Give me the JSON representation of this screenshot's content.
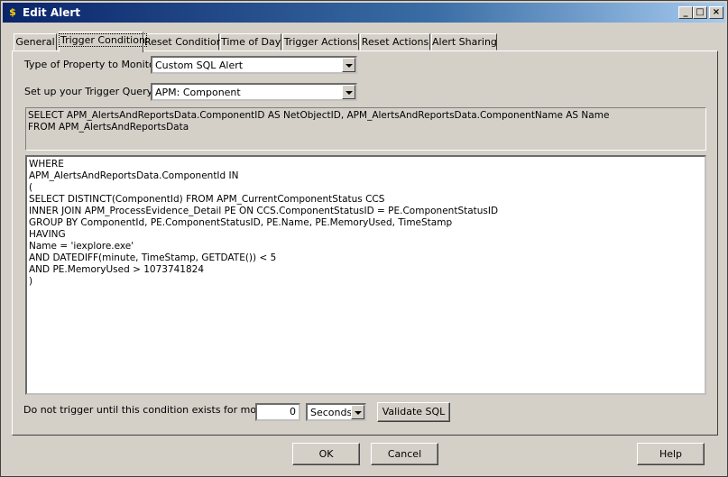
{
  "window": {
    "title": "Edit Alert"
  },
  "titlebar_buttons": {
    "minimize": "_",
    "maximize": "□",
    "close": "×"
  },
  "tabs": [
    {
      "label": "General"
    },
    {
      "label": "Trigger Condition"
    },
    {
      "label": "Reset Condition"
    },
    {
      "label": "Time of Day"
    },
    {
      "label": "Trigger Actions"
    },
    {
      "label": "Reset Actions"
    },
    {
      "label": "Alert Sharing"
    }
  ],
  "form": {
    "property_label": "Type of Property to Monitor:",
    "property_value": "Custom SQL Alert",
    "query_label": "Set up your Trigger Query",
    "query_value": "APM: Component"
  },
  "sql_header": [
    "SELECT APM_AlertsAndReportsData.ComponentID AS NetObjectID, APM_AlertsAndReportsData.ComponentName AS Name",
    "FROM APM_AlertsAndReportsData"
  ],
  "sql_body": [
    "WHERE",
    "APM_AlertsAndReportsData.ComponentId IN",
    "(",
    "SELECT DISTINCT(ComponentId) FROM APM_CurrentComponentStatus CCS",
    "INNER JOIN APM_ProcessEvidence_Detail PE ON CCS.ComponentStatusID = PE.ComponentStatusID",
    "GROUP BY ComponentId, PE.ComponentStatusID, PE.Name, PE.MemoryUsed, TimeStamp",
    "HAVING",
    "Name = 'iexplore.exe'",
    "AND DATEDIFF(minute, TimeStamp, GETDATE()) < 5",
    "AND PE.MemoryUsed > 1073741824",
    ")"
  ],
  "duration": {
    "label": "Do not trigger until this condition exists for more than",
    "value": "0",
    "unit": "Seconds",
    "validate_label": "Validate SQL"
  },
  "footer": {
    "ok": "OK",
    "cancel": "Cancel",
    "help": "Help"
  }
}
